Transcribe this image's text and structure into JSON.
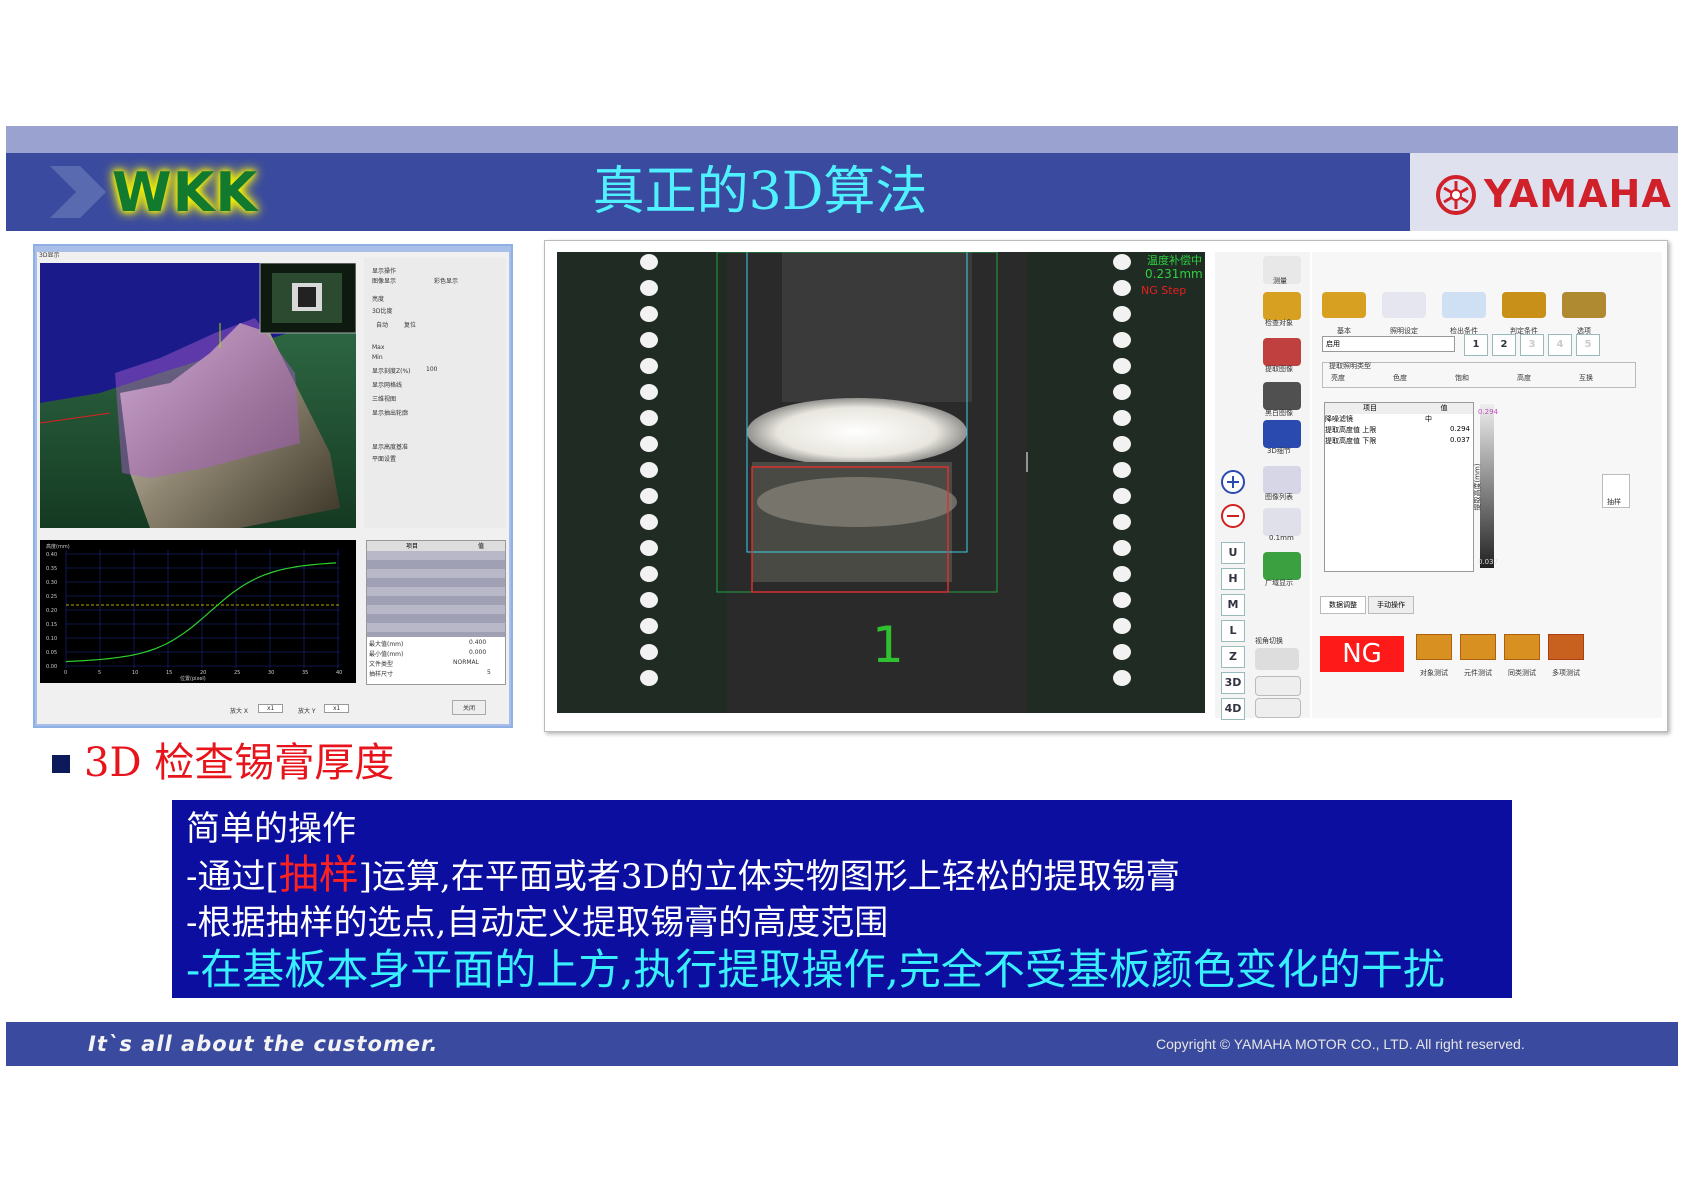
{
  "header": {
    "logo": "WKK",
    "title": "真正的3D算法",
    "brand": "YAMAHA"
  },
  "left_window": {
    "tab_title": "3D显示",
    "options": [
      "显示操作",
      "图像显示",
      "彩色显示",
      "亮度",
      "3D比度",
      "自动",
      "复位",
      "Max",
      "Min",
      "显示刻度Z(%)",
      "100",
      "显示网格线",
      "三维视图",
      "显示抽出轮廓",
      "显示高度基准",
      "平面设置"
    ],
    "table_headers": [
      "项目",
      "值"
    ],
    "table_rows": [
      [
        "最大值(mm)",
        "0.400"
      ],
      [
        "最小值(mm)",
        "0.000"
      ],
      [
        "文件类型",
        "NORMAL"
      ],
      [
        "抽样尺寸",
        "5"
      ]
    ],
    "zoom_x_label": "放大 X",
    "zoom_x_value": "x1",
    "zoom_y_label": "放大 Y",
    "zoom_y_value": "x1",
    "close_label": "关闭",
    "graph_ylabel": "高度(mm)",
    "graph_xlabel": "位置(pixel)",
    "graph_yticks": [
      "0.40",
      "0.35",
      "0.30",
      "0.25",
      "0.20",
      "0.15",
      "0.10",
      "0.05",
      "0.00"
    ],
    "graph_xticks": [
      "0",
      "5",
      "10",
      "15",
      "20",
      "25",
      "30",
      "35",
      "40"
    ]
  },
  "right_window": {
    "overlay_lines": [
      "温度补偿中",
      "0.231mm",
      "NG Step"
    ],
    "region_number": "1",
    "side_buttons": [
      "U",
      "H",
      "M",
      "L",
      "Z",
      "3D",
      "4D"
    ],
    "toolbar_labels": [
      "测量",
      "检查对象",
      "提取图像",
      "黑白图像",
      "3D细节",
      "图像列表",
      "0.1mm",
      "广域显示",
      "视角切换"
    ],
    "tabs_top": [
      "基本",
      "照明设定",
      "检出条件",
      "判定条件",
      "选项"
    ],
    "mode_select": "启用",
    "page_numbers": [
      "1",
      "2",
      "3",
      "4",
      "5"
    ],
    "extract_group_label": "提取照明类型",
    "extract_options": [
      "亮度",
      "色度",
      "饱和",
      "高度",
      "互换"
    ],
    "table_headers": [
      "项目",
      "值"
    ],
    "table_rows": [
      [
        "降噪滤镜",
        "中"
      ],
      [
        "提取高度值 上限",
        "0.294"
      ],
      [
        "提取高度值 下限",
        "0.037"
      ]
    ],
    "scale_top": "0.294",
    "scale_bottom": "0.037",
    "scale_label": "提取高度(mm)",
    "sample_label": "抽样",
    "bottom_tabs": [
      "数据调整",
      "手动操作"
    ],
    "ng_label": "NG",
    "test_buttons": [
      "对象测试",
      "元件测试",
      "同类测试",
      "多项测试"
    ]
  },
  "bullet": "3D 检查锡膏厚度",
  "infobox": {
    "line1": "简单的操作",
    "line2_prefix": "-通过[",
    "line2_highlight": "抽样",
    "line2_suffix": "]运算,在平面或者3D的立体实物图形上轻松的提取锡膏",
    "line3": "-根据抽样的选点,自动定义提取锡膏的高度范围",
    "line4": "-在基板本身平面的上方,执行提取操作,完全不受基板颜色变化的干扰"
  },
  "footer": {
    "slogan": "It`s all about the customer.",
    "copyright": "Copyright © YAMAHA MOTOR CO., LTD.  All right reserved."
  },
  "colors": {
    "header_bar": "#3a4a9e",
    "title_cyan": "#4ff0ff",
    "info_box": "#0b0e9e",
    "bullet_red": "#e8141c",
    "ng_red": "#ff1a1a"
  }
}
